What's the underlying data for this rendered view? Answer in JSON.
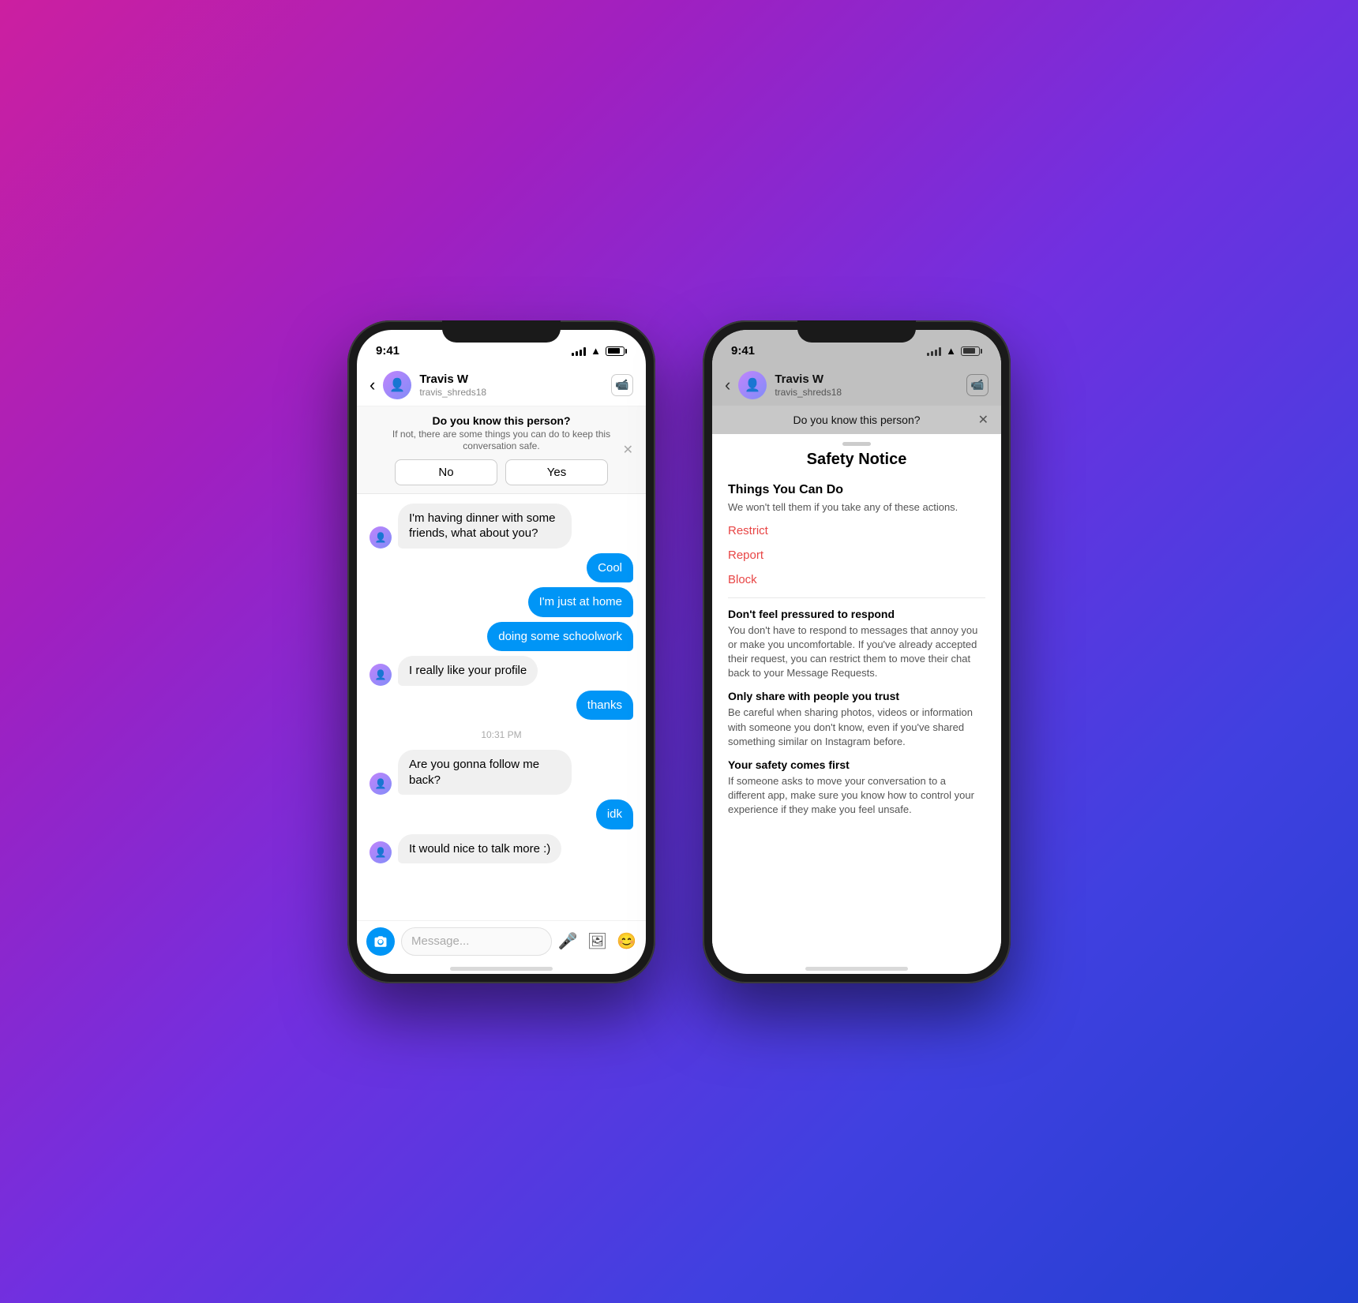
{
  "background": {
    "gradient": "linear-gradient(135deg, #cc1fa0, #a020c0, #7030e0, #4040e0, #2040d0)"
  },
  "phone1": {
    "status": {
      "time": "9:41"
    },
    "header": {
      "contact_name": "Travis W",
      "contact_handle": "travis_shreds18",
      "back_label": "‹",
      "video_icon": "⬜"
    },
    "safety_banner": {
      "title": "Do you know this person?",
      "subtitle": "If not, there are some things you can do to keep this conversation safe.",
      "no_label": "No",
      "yes_label": "Yes"
    },
    "messages": [
      {
        "type": "received",
        "text": "I'm having dinner with some friends, what about you?",
        "show_avatar": true
      },
      {
        "type": "sent",
        "text": "Cool"
      },
      {
        "type": "sent",
        "text": "I'm just at home"
      },
      {
        "type": "sent",
        "text": "doing some schoolwork"
      },
      {
        "type": "received",
        "text": "I really like your profile",
        "show_avatar": true
      },
      {
        "type": "sent",
        "text": "thanks"
      },
      {
        "type": "timestamp",
        "text": "10:31 PM"
      },
      {
        "type": "received",
        "text": "Are you gonna follow me back?",
        "show_avatar": true
      },
      {
        "type": "sent",
        "text": "idk"
      },
      {
        "type": "received",
        "text": "It would nice to talk more :)",
        "show_avatar": true
      }
    ],
    "input_bar": {
      "placeholder": "Message...",
      "camera_icon": "📷",
      "mic_icon": "🎤",
      "gallery_icon": "🖼",
      "sticker_icon": "☺"
    }
  },
  "phone2": {
    "status": {
      "time": "9:41"
    },
    "header": {
      "contact_name": "Travis W",
      "contact_handle": "travis_shreds18",
      "back_label": "‹"
    },
    "safety_banner": {
      "title": "Do you know this person?"
    },
    "safety_notice": {
      "heading": "Safety Notice",
      "things_title": "Things You Can Do",
      "things_sub": "We won't tell them if you take any of these actions.",
      "actions": [
        "Restrict",
        "Report",
        "Block"
      ],
      "tip1_title": "Don't feel pressured to respond",
      "tip1_body": "You don't have to respond to messages that annoy you or make you uncomfortable. If you've already accepted their request, you can restrict them to move their chat back to your Message Requests.",
      "tip2_title": "Only share with people you trust",
      "tip2_body": "Be careful when sharing photos, videos or information with someone you don't know, even if you've shared something similar on Instagram before.",
      "tip3_title": "Your safety comes first",
      "tip3_body": "If someone asks to move your conversation to a different app, make sure you know how to control your experience if they make you feel unsafe."
    }
  }
}
